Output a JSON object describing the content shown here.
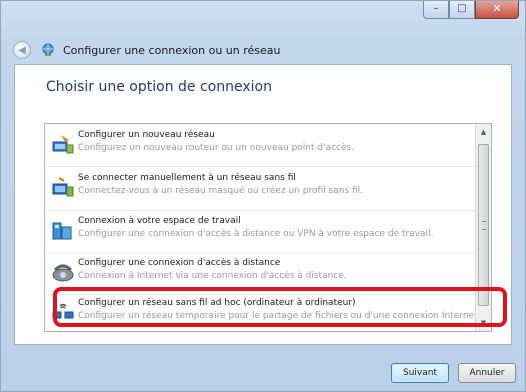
{
  "window": {
    "title": "Configurer une connexion ou un réseau",
    "caption": {
      "minimize": "–",
      "maximize": "□",
      "close": "✕"
    }
  },
  "content": {
    "heading": "Choisir une option de connexion"
  },
  "options": [
    {
      "title": "Configurer un nouveau réseau",
      "description": "Configurez un nouveau routeur ou un nouveau point d'accès.",
      "icon": "network-setup-icon"
    },
    {
      "title": "Se connecter manuellement à un réseau sans fil",
      "description": "Connectez-vous à un réseau masqué ou créez un profil sans fil.",
      "icon": "wireless-connect-icon"
    },
    {
      "title": "Connexion à votre espace de travail",
      "description": "Configurer une connexion d'accès à distance ou VPN à votre espace de travail.",
      "icon": "workplace-icon"
    },
    {
      "title": "Configurer une connexion d'accès à distance",
      "description": "Connexion à Internet via une connexion d'accès à distance.",
      "icon": "dialup-phone-icon"
    },
    {
      "title": "Configurer un réseau sans fil ad hoc (ordinateur à ordinateur)",
      "description": "Configurer un réseau temporaire pour le partage de fichiers ou d'une connexion Internet.",
      "icon": "adhoc-network-icon"
    }
  ],
  "buttons": {
    "next": "Suivant",
    "cancel": "Annuler"
  },
  "colors": {
    "highlight": "#e0121b",
    "heading": "#1e3b72"
  }
}
